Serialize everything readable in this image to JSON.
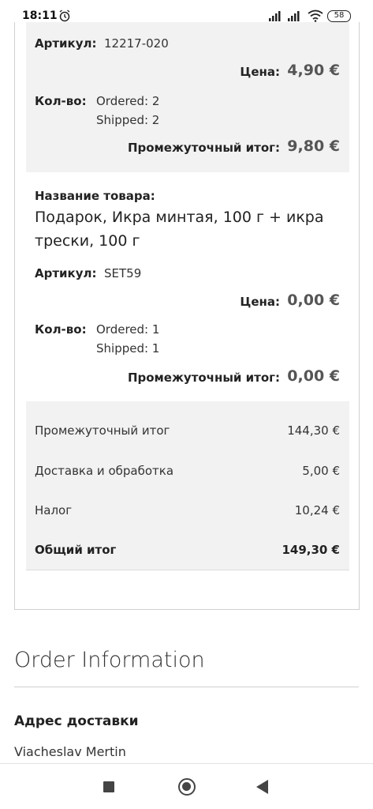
{
  "status_bar": {
    "time": "18:11",
    "battery": "58",
    "icons": [
      "alarm-icon",
      "signal-icon",
      "signal-icon",
      "wifi-icon",
      "battery-icon"
    ]
  },
  "item1": {
    "sku_label": "Артикул:",
    "sku": "12217-020",
    "price_label": "Цена:",
    "price": "4,90 €",
    "qty_label": "Кол-во:",
    "ordered": "Ordered: 2",
    "shipped": "Shipped: 2",
    "subtotal_label": "Промежуточный итог:",
    "subtotal": "9,80 €"
  },
  "item2": {
    "name_label": "Название товара:",
    "name_line1": "Подарок, Икра минтая, 100 г + икра",
    "name_line2": "трески, 100 г",
    "sku_label": "Артикул:",
    "sku": "SET59",
    "price_label": "Цена:",
    "price": "0,00 €",
    "qty_label": "Кол-во:",
    "ordered": "Ordered: 1",
    "shipped": "Shipped: 1",
    "subtotal_label": "Промежуточный итог:",
    "subtotal": "0,00 €"
  },
  "totals": {
    "subtotal_label": "Промежуточный итог",
    "subtotal": "144,30 €",
    "shipping_label": "Доставка и обработка",
    "shipping": "5,00 €",
    "tax_label": "Налог",
    "tax": "10,24 €",
    "grand_label": "Общий итог",
    "grand": "149,30 €"
  },
  "order_info": {
    "title": "Order Information",
    "address_title": "Адрес доставки",
    "address_name": "Viacheslav Mertin"
  },
  "colors": {
    "panel_bg": "#f2f2f2",
    "price_text": "#555555"
  }
}
